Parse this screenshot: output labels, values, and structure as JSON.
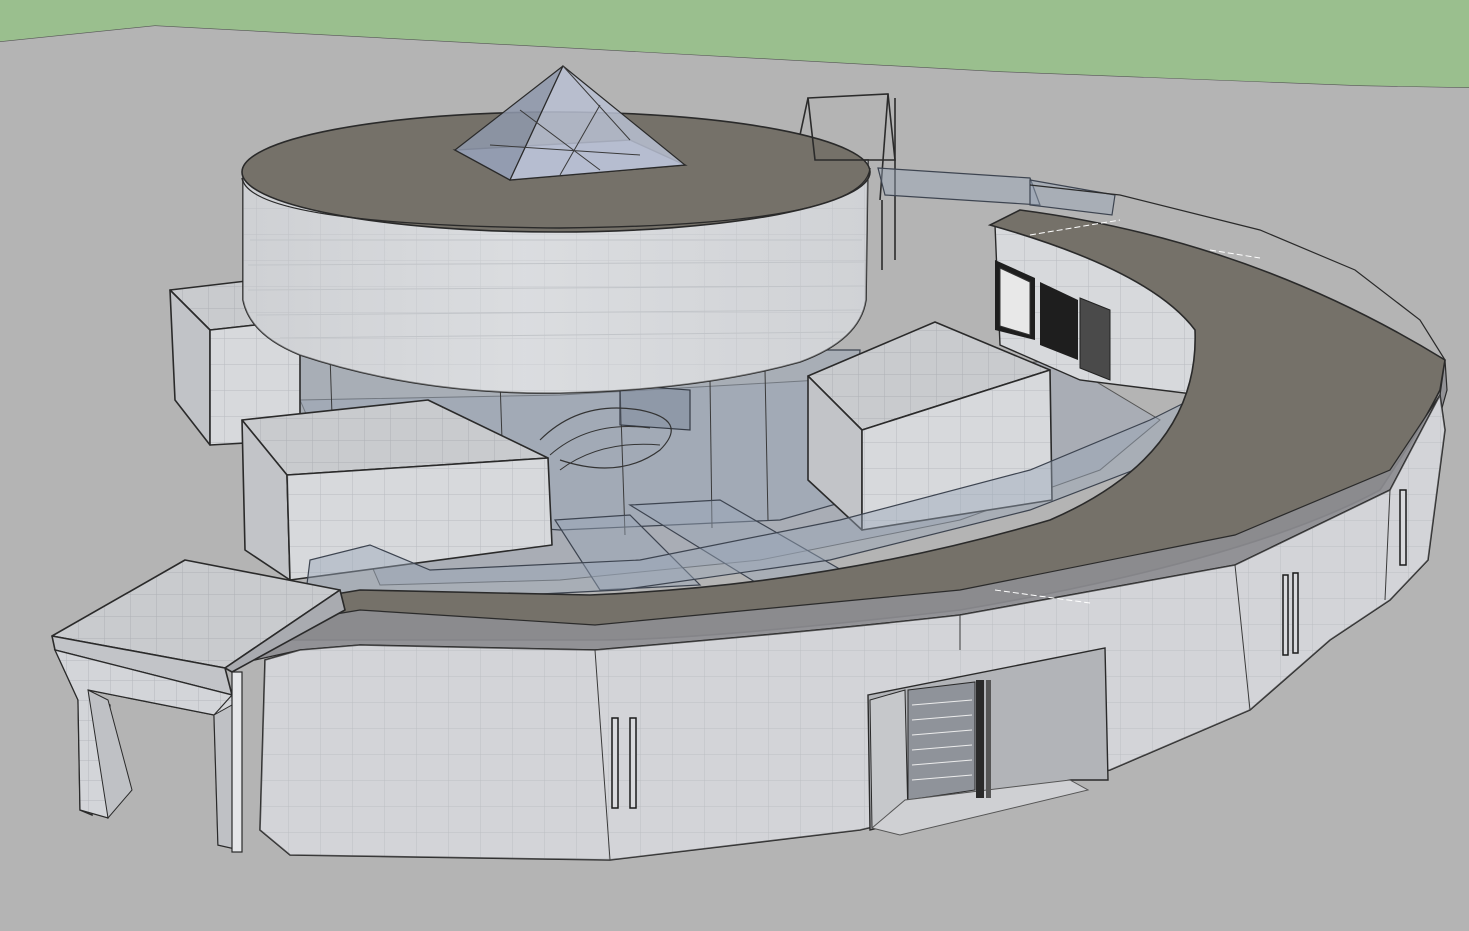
{
  "scene": {
    "ground_color": "#b4b4b4",
    "sky_color": "#9abf8e",
    "roof_color": "#757169",
    "wall_color": "#d8dadd",
    "glass_color": "#9aa6b8"
  }
}
